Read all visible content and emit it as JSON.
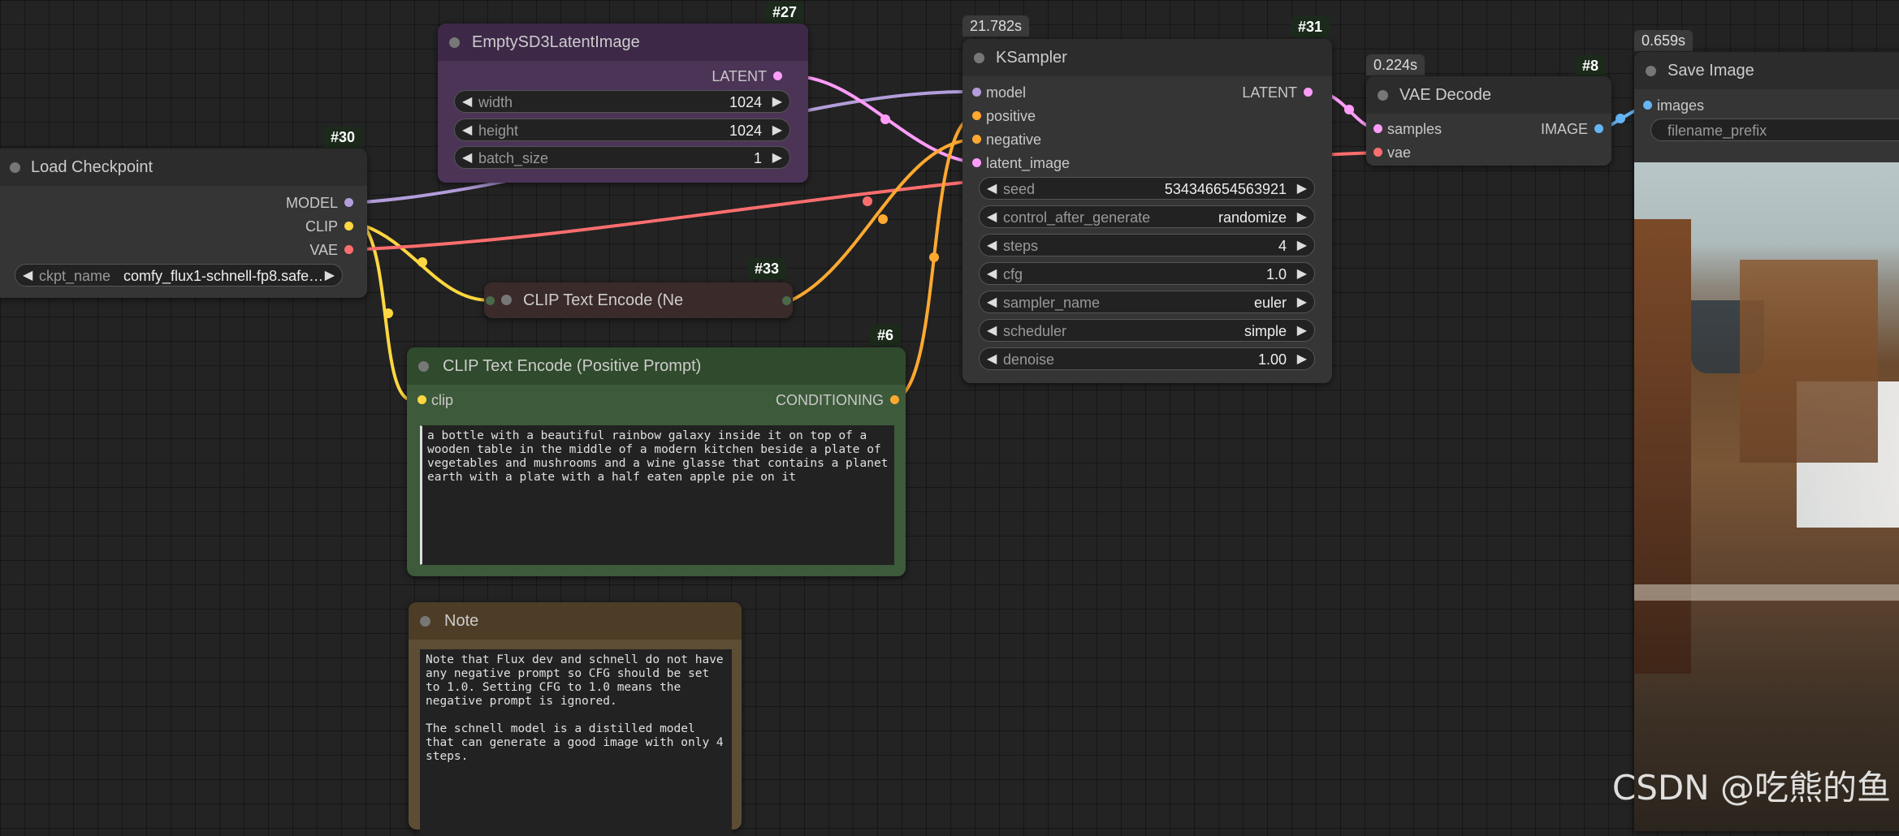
{
  "colors": {
    "canvas": "#232323",
    "model": "#b39ddb",
    "clip": "#ffd740",
    "vae": "#ff6e6e",
    "latent": "#ff9cf9",
    "conditioning": "#ffa931",
    "image": "#64b5f6"
  },
  "nodes": {
    "load_checkpoint": {
      "id": "#30",
      "title": "Load Checkpoint",
      "outputs": [
        "MODEL",
        "CLIP",
        "VAE"
      ],
      "widget": {
        "name": "ckpt_name",
        "value": "comfy_flux1-schnell-fp8.safe…"
      }
    },
    "empty_latent": {
      "id": "#27",
      "title": "EmptySD3LatentImage",
      "output": "LATENT",
      "widgets": [
        {
          "name": "width",
          "value": "1024"
        },
        {
          "name": "height",
          "value": "1024"
        },
        {
          "name": "batch_size",
          "value": "1"
        }
      ]
    },
    "clip_negative": {
      "id": "#33",
      "title": "CLIP Text Encode (Ne"
    },
    "clip_positive": {
      "id": "#6",
      "title": "CLIP Text Encode (Positive Prompt)",
      "input": "clip",
      "output": "CONDITIONING",
      "text": "a bottle with a beautiful rainbow galaxy inside it on top of a\nwooden table in the middle of a modern kitchen beside a plate of\nvegetables and mushrooms and a wine glasse that contains a planet\nearth with a plate with a half eaten apple pie on it"
    },
    "note": {
      "title": "Note",
      "text": "Note that Flux dev and schnell do not have\nany negative prompt so CFG should be set\nto 1.0. Setting CFG to 1.0 means the\nnegative prompt is ignored.\n\nThe schnell model is a distilled model\nthat can generate a good image with only 4\nsteps."
    },
    "ksampler": {
      "id": "#31",
      "timing": "21.782s",
      "title": "KSampler",
      "inputs": [
        "model",
        "positive",
        "negative",
        "latent_image"
      ],
      "output": "LATENT",
      "widgets": [
        {
          "name": "seed",
          "value": "534346654563921"
        },
        {
          "name": "control_after_generate",
          "value": "randomize"
        },
        {
          "name": "steps",
          "value": "4"
        },
        {
          "name": "cfg",
          "value": "1.0"
        },
        {
          "name": "sampler_name",
          "value": "euler"
        },
        {
          "name": "scheduler",
          "value": "simple"
        },
        {
          "name": "denoise",
          "value": "1.00"
        }
      ]
    },
    "vae_decode": {
      "id": "#8",
      "timing": "0.224s",
      "title": "VAE Decode",
      "inputs": [
        "samples",
        "vae"
      ],
      "output": "IMAGE"
    },
    "save_image": {
      "timing": "0.659s",
      "title": "Save Image",
      "input": "images",
      "widget_name": "filename_prefix"
    }
  },
  "watermark": "CSDN @吃熊的鱼"
}
